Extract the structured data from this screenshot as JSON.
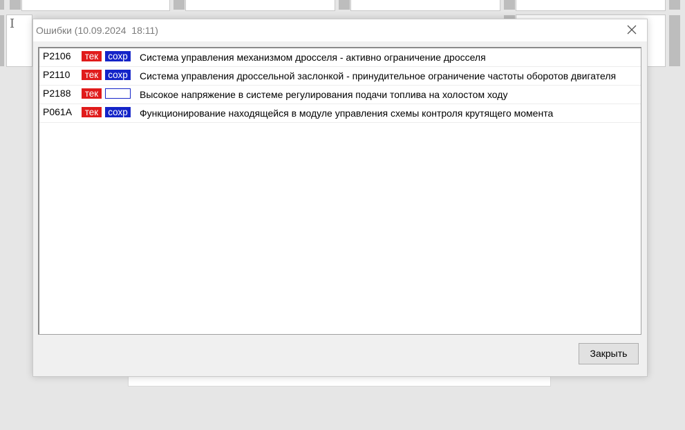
{
  "dialog": {
    "title": "Ошибки (10.09.2024  18:11)",
    "close_button": "Закрыть",
    "rows": [
      {
        "code": "P2106",
        "current": "тек",
        "saved": "сохр",
        "text": "Система управления механизмом дросселя - активно ограничение дросселя"
      },
      {
        "code": "P2110",
        "current": "тек",
        "saved": "сохр",
        "text": "Система управления дроссельной заслонкой - принудительное ограничение частоты оборотов двигателя"
      },
      {
        "code": "P2188",
        "current": "тек",
        "saved": "",
        "text": "Высокое напряжение в системе регулирования подачи топлива на холостом ходу"
      },
      {
        "code": "P061A",
        "current": "тек",
        "saved": "сохр",
        "text": "Функционирование находящейся в модуле управления схемы контроля крутящего момента"
      }
    ]
  },
  "colors": {
    "current_tag": "#e01b1b",
    "saved_tag": "#1424c8"
  },
  "icons": {
    "close": "close-icon",
    "text_cursor": "text-cursor-icon"
  }
}
